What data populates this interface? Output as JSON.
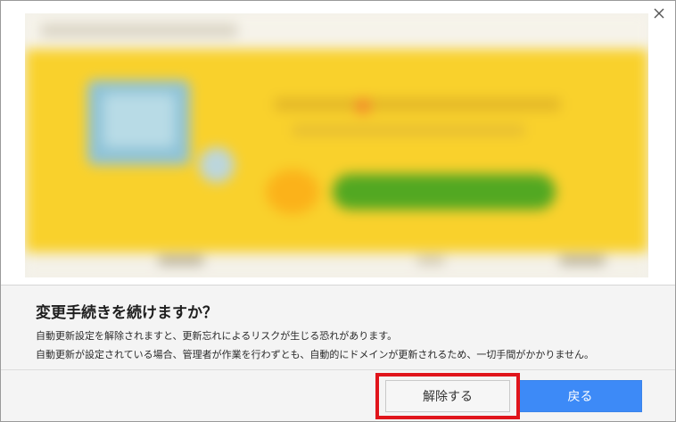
{
  "dialog": {
    "title": "変更手続きを続けますか？",
    "message_line1": "自動更新設定を解除されますと、更新忘れによるリスクが生じる恐れがあります。",
    "message_line2": "自動更新が設定されている場合、管理者が作業を行わずとも、自動的にドメインが更新されるため、一切手間がかかりません。",
    "buttons": {
      "cancel_label": "解除する",
      "back_label": "戻る"
    },
    "close_icon": "close-icon"
  },
  "colors": {
    "primary_button": "#3d8af7",
    "highlight_border": "#e0141b",
    "banner_yellow": "#f9d12c",
    "banner_green": "#52a822"
  }
}
